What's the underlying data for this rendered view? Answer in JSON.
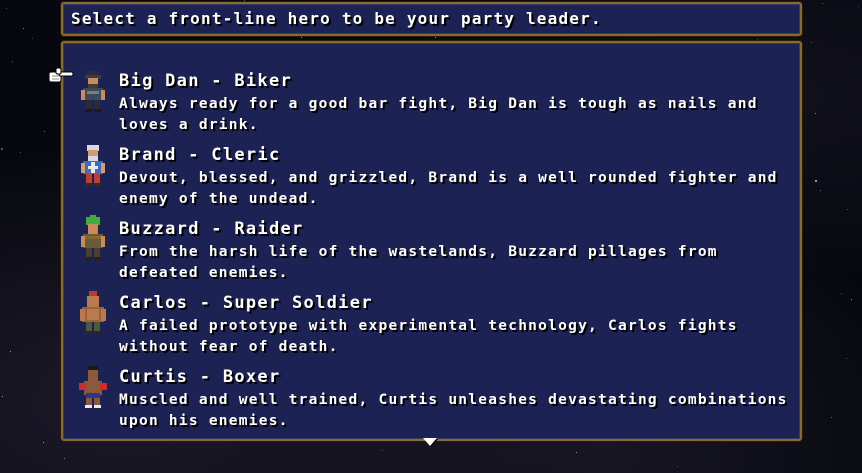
{
  "prompt": "Select a front-line hero to be your party leader.",
  "heroes": [
    {
      "name": "Big Dan - Biker",
      "description": "Always ready for a good bar fight, Big Dan is tough as nails and loves a drink.",
      "portrait_icon": "biker-portrait-icon",
      "colors": {
        "hair": "#2b2b3a",
        "skin": "#c88b5e",
        "outfit": "#3b4a5a",
        "accent": "#7a7a86"
      }
    },
    {
      "name": "Brand - Cleric",
      "description": "Devout, blessed, and grizzled, Brand is a well rounded fighter and enemy of the undead.",
      "portrait_icon": "cleric-portrait-icon",
      "colors": {
        "hair": "#d9d9e6",
        "skin": "#d49a70",
        "outfit": "#3e6db5",
        "accent": "#c04030"
      }
    },
    {
      "name": "Buzzard - Raider",
      "description": "From the harsh life of the wastelands, Buzzard pillages from defeated enemies.",
      "portrait_icon": "raider-portrait-icon",
      "colors": {
        "hair": "#3fae3f",
        "skin": "#c88b5e",
        "outfit": "#6b5a3a",
        "accent": "#8a6a2a"
      }
    },
    {
      "name": "Carlos - Super Soldier",
      "description": "A failed prototype with experimental technology, Carlos fights without fear of death.",
      "portrait_icon": "soldier-portrait-icon",
      "colors": {
        "hair": "#c03a2a",
        "skin": "#b87a50",
        "outfit": "#4a5a3a",
        "accent": "#a06030"
      }
    },
    {
      "name": "Curtis - Boxer",
      "description": "Muscled and well trained, Curtis unleashes devastating combinations upon his enemies.",
      "portrait_icon": "boxer-portrait-icon",
      "colors": {
        "hair": "#1a1a1a",
        "skin": "#8a5a3a",
        "outfit": "#2a3a8a",
        "accent": "#d02a2a"
      }
    }
  ],
  "selected_index": 0,
  "icons": {
    "cursor": "pointing-hand-icon",
    "scroll": "scroll-down-arrow-icon"
  },
  "theme": {
    "panel_bg": "#1c2354",
    "panel_border": "#8a6a2a",
    "text": "#ffffff"
  }
}
